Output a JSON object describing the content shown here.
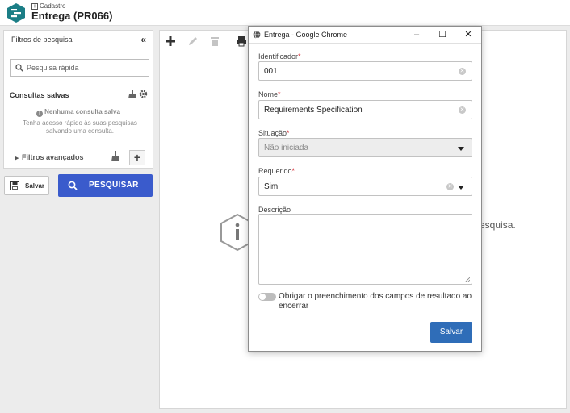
{
  "header": {
    "breadcrumb": "Cadastro",
    "title": "Entrega (PR066)"
  },
  "filters": {
    "title": "Filtros de pesquisa",
    "quick_search_placeholder": "Pesquisa rápida",
    "saved_queries_title": "Consultas salvas",
    "no_saved_title": "Nenhuma consulta salva",
    "no_saved_desc": "Tenha acesso rápido às suas pesquisas salvando uma consulta.",
    "advanced_label": "Filtros avançados",
    "save_label": "Salvar",
    "search_label": "PESQUISAR"
  },
  "main": {
    "empty_message_suffix": "esquisa."
  },
  "dialog": {
    "window_title": "Entrega - Google Chrome",
    "fields": {
      "identifier": {
        "label": "Identificador",
        "required_mark": "*",
        "value": "001"
      },
      "name": {
        "label": "Nome",
        "required_mark": "*",
        "value": "Requirements Specification"
      },
      "status": {
        "label": "Situação",
        "required_mark": "*",
        "value": "Não iniciada"
      },
      "required": {
        "label": "Requerido",
        "required_mark": "*",
        "value": "Sim"
      },
      "description": {
        "label": "Descrição",
        "value": ""
      }
    },
    "toggle_label": "Obrigar o preenchimento dos campos de resultado ao encerrar",
    "toggle_on": false,
    "save_label": "Salvar"
  },
  "colors": {
    "brand_teal": "#1b7e86",
    "search_button": "#3a5bcc",
    "dialog_save_button": "#2f6db8",
    "required_mark": "#d9363e"
  }
}
